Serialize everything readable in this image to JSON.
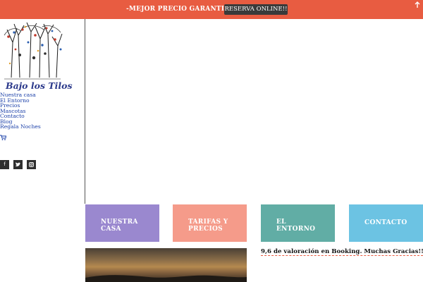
{
  "promo": {
    "text": "-MEJOR PRECIO GARANTIZADO-",
    "button_label": "RESERVA ONLINE!!",
    "close_icon": "arrow-up-icon"
  },
  "sidebar": {
    "logo_text": "Bajo los Tilos",
    "nav": [
      {
        "label": "Nuestra casa"
      },
      {
        "label": "El Entorno"
      },
      {
        "label": "Precios"
      },
      {
        "label": "Mascotas"
      },
      {
        "label": "Contacto"
      },
      {
        "label": "Blog"
      },
      {
        "label": "Regala Noches"
      }
    ],
    "cart_icon": "cart-icon",
    "social": [
      {
        "icon": "facebook-icon",
        "glyph": "f"
      },
      {
        "icon": "twitter-icon",
        "glyph": "t"
      },
      {
        "icon": "instagram-icon",
        "glyph": "◎"
      }
    ]
  },
  "tiles": [
    {
      "label": "NUESTRA\nCASA",
      "color": "#9a88cf"
    },
    {
      "label": "TARIFAS Y\nPRECIOS",
      "color": "#f59b8a"
    },
    {
      "label": "EL\nENTORNO",
      "color": "#61ada5"
    },
    {
      "label": "CONTACTO",
      "color": "#6cc3e3"
    }
  ],
  "review": {
    "text": "9,6 de valoración en Booking. Muchas Gracias!!!"
  },
  "colors": {
    "promo_bar": "#e85c41",
    "button": "#3a3a3a",
    "link": "#1a3fa8"
  }
}
